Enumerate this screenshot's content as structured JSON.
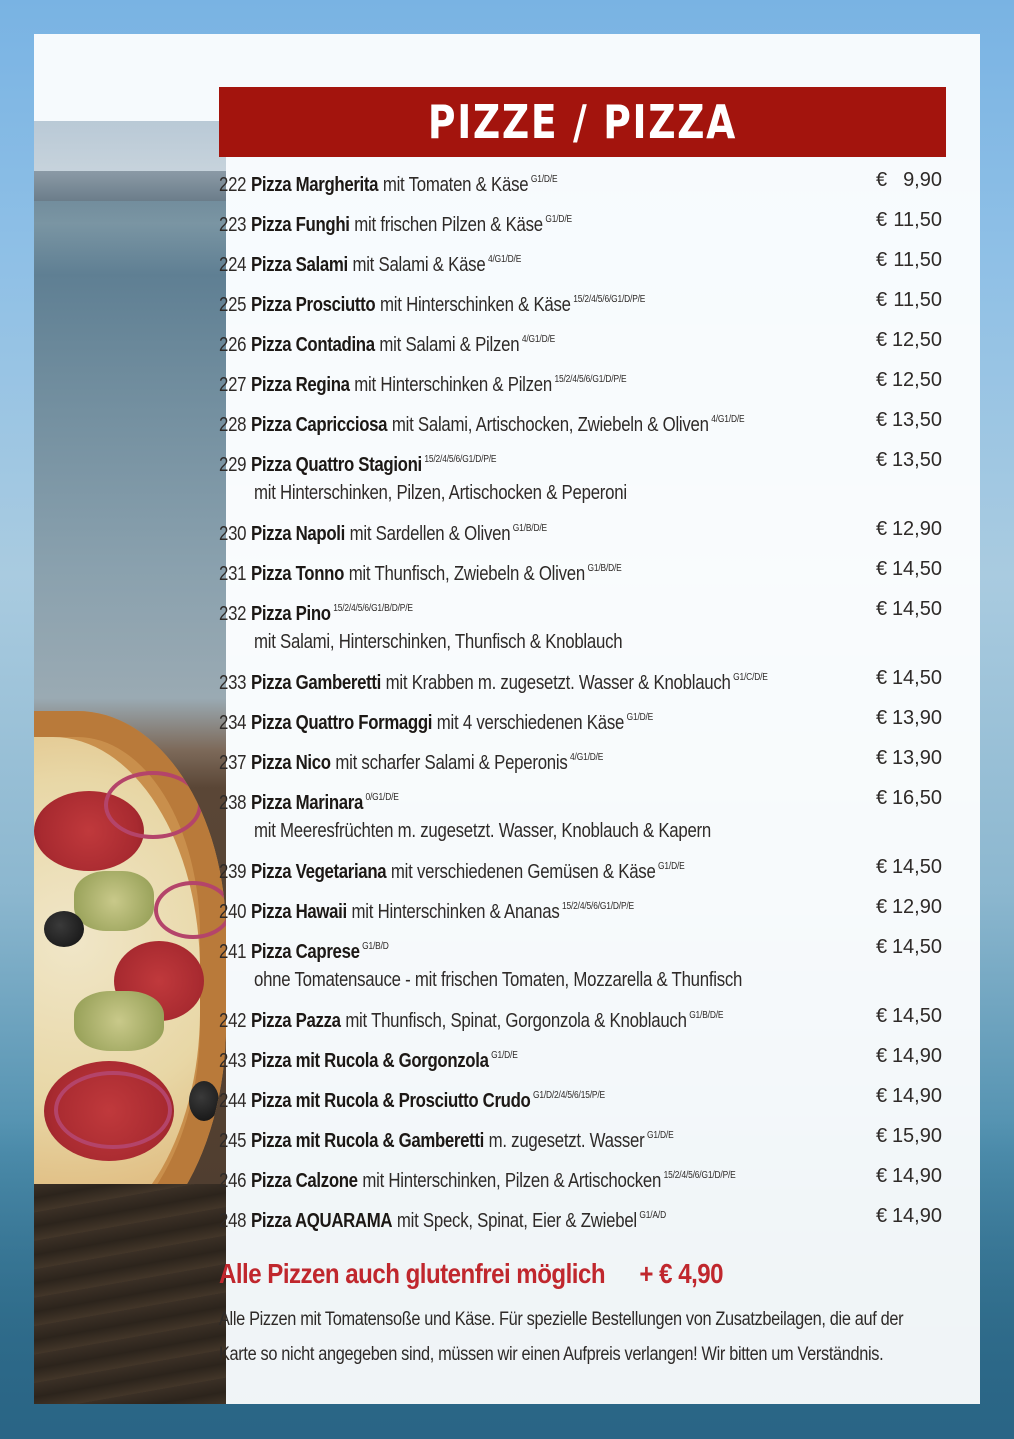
{
  "title": "PIZZE / PIZZA",
  "currency": "€",
  "items": [
    {
      "num": "222",
      "name": "Pizza Margherita",
      "desc": "mit Tomaten & Käse",
      "allergens": "G1/D/E",
      "price": "9,90"
    },
    {
      "num": "223",
      "name": "Pizza Funghi",
      "desc": "mit frischen Pilzen & Käse",
      "allergens": "G1/D/E",
      "price": "11,50"
    },
    {
      "num": "224",
      "name": "Pizza Salami",
      "desc": "mit Salami & Käse",
      "allergens": "4/G1/D/E",
      "price": "11,50"
    },
    {
      "num": "225",
      "name": "Pizza Prosciutto",
      "desc": "mit Hinterschinken & Käse",
      "allergens": "15/2/4/5/6/G1/D/P/E",
      "price": "11,50"
    },
    {
      "num": "226",
      "name": "Pizza Contadina",
      "desc": "mit Salami & Pilzen",
      "allergens": "4/G1/D/E",
      "price": "12,50"
    },
    {
      "num": "227",
      "name": "Pizza Regina",
      "desc": "mit Hinterschinken & Pilzen",
      "allergens": "15/2/4/5/6/G1/D/P/E",
      "price": "12,50"
    },
    {
      "num": "228",
      "name": "Pizza Capricciosa",
      "desc": "mit Salami, Artischocken, Zwiebeln & Oliven",
      "allergens": "4/G1/D/E",
      "price": "13,50"
    },
    {
      "num": "229",
      "name": "Pizza Quattro Stagioni",
      "desc": "",
      "allergens": "15/2/4/5/6/G1/D/P/E",
      "price": "13,50",
      "desc2": "mit Hinterschinken, Pilzen, Artischocken & Peperoni"
    },
    {
      "num": "230",
      "name": "Pizza Napoli",
      "desc": "mit Sardellen & Oliven",
      "allergens": "G1/B/D/E",
      "price": "12,90"
    },
    {
      "num": "231",
      "name": "Pizza Tonno",
      "desc": "mit Thunfisch, Zwiebeln & Oliven",
      "allergens": "G1/B/D/E",
      "price": "14,50"
    },
    {
      "num": "232",
      "name": "Pizza Pino",
      "desc": "",
      "allergens": "15/2/4/5/6/G1/B/D/P/E",
      "price": "14,50",
      "desc2": "mit Salami, Hinterschinken, Thunfisch & Knoblauch"
    },
    {
      "num": "233",
      "name": "Pizza Gamberetti",
      "desc": "mit Krabben m. zugesetzt. Wasser & Knoblauch",
      "allergens": "G1/C/D/E",
      "price": "14,50"
    },
    {
      "num": "234",
      "name": "Pizza Quattro Formaggi",
      "desc": "mit 4 verschiedenen Käse",
      "allergens": "G1/D/E",
      "price": "13,90"
    },
    {
      "num": "237",
      "name": "Pizza Nico",
      "desc": "mit scharfer Salami & Peperonis",
      "allergens": "4/G1/D/E",
      "price": "13,90"
    },
    {
      "num": "238",
      "name": "Pizza Marinara",
      "desc": "",
      "allergens": "0/G1/D/E",
      "price": "16,50",
      "desc2": "mit Meeresfrüchten m. zugesetzt. Wasser, Knoblauch & Kapern"
    },
    {
      "num": "239",
      "name": "Pizza Vegetariana",
      "desc": "mit verschiedenen Gemüsen & Käse",
      "allergens": "G1/D/E",
      "price": "14,50"
    },
    {
      "num": "240",
      "name": "Pizza Hawaii",
      "desc": "mit Hinterschinken & Ananas",
      "allergens": "15/2/4/5/6/G1/D/P/E",
      "price": "12,90"
    },
    {
      "num": "241",
      "name": "Pizza Caprese",
      "desc": "",
      "allergens": "G1/B/D",
      "price": "14,50",
      "desc2": "ohne Tomatensauce - mit frischen Tomaten, Mozzarella & Thunfisch"
    },
    {
      "num": "242",
      "name": "Pizza Pazza",
      "desc": "mit Thunfisch, Spinat, Gorgonzola & Knoblauch",
      "allergens": "G1/B/D/E",
      "price": "14,50"
    },
    {
      "num": "243",
      "name": "Pizza mit Rucola & Gorgonzola",
      "desc": "",
      "allergens": "G1/D/E",
      "price": "14,90"
    },
    {
      "num": "244",
      "name": "Pizza mit Rucola & Prosciutto Crudo",
      "desc": "",
      "allergens": "G1/D/2/4/5/6/15/P/E",
      "price": "14,90"
    },
    {
      "num": "245",
      "name": "Pizza mit Rucola & Gamberetti",
      "desc": "m. zugesetzt. Wasser",
      "allergens": "G1/D/E",
      "price": "15,90"
    },
    {
      "num": "246",
      "name": "Pizza Calzone",
      "desc": "mit Hinterschinken, Pilzen & Artischocken",
      "allergens": "15/2/4/5/6/G1/D/P/E",
      "price": "14,90"
    },
    {
      "num": "248",
      "name": "Pizza AQUARAMA",
      "desc": "mit Speck, Spinat, Eier & Zwiebel",
      "allergens": "G1/A/D",
      "price": "14,90"
    }
  ],
  "glutenfree": {
    "text": "Alle Pizzen auch glutenfrei möglich",
    "extra": "+ € 4,90"
  },
  "note": {
    "line1": "Alle Pizzen mit Tomatensoße und Käse. Für spezielle Bestellungen von Zusatzbeilagen, die auf der",
    "line2": "Karte so nicht angegeben sind, müssen wir einen Aufpreis verlangen! Wir bitten um Verständnis."
  },
  "colors": {
    "accent": "#a3140d",
    "highlight": "#c0272d"
  }
}
